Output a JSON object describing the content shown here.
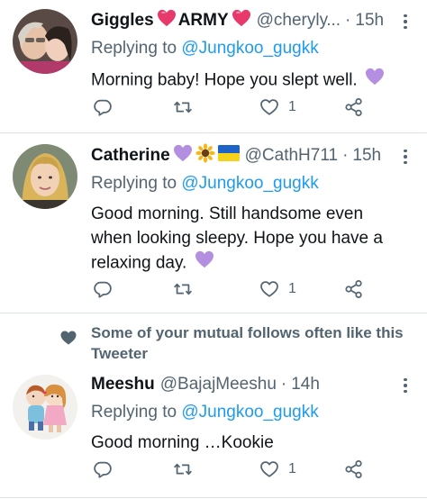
{
  "tweets": [
    {
      "name": "Giggles",
      "name_suffix": "ARMY",
      "handle": "@cherylу...",
      "time": "15h",
      "replying_prefix": "Replying to",
      "replying_to": "@Jungkoo_gugkk",
      "text": "Morning baby! Hope you slept well.",
      "likes": "1"
    },
    {
      "name": "Catherine",
      "handle": "@CathH711",
      "time": "15h",
      "replying_prefix": "Replying to",
      "replying_to": "@Jungkoo_gugkk",
      "text": "Good morning. Still handsome even when looking sleepy. Hope you have a relaxing day.",
      "likes": "1"
    },
    {
      "name": "Meeshu",
      "handle": "@BajajMeeshu",
      "time": "14h",
      "replying_prefix": "Replying to",
      "replying_to": "@Jungkoo_gugkk",
      "text": "Good morning …Kookie",
      "likes": "1"
    }
  ],
  "social_context": "Some of your mutual follows often like this Tweeter",
  "colors": {
    "link": "#1d9bf0",
    "muted": "#536471",
    "text": "#0f1419",
    "heart_emoji": "#e8396b",
    "purple_heart": "#b48ee0"
  },
  "icons": [
    "reply-icon",
    "retweet-icon",
    "like-icon",
    "share-icon",
    "more-icon",
    "heart-icon"
  ]
}
